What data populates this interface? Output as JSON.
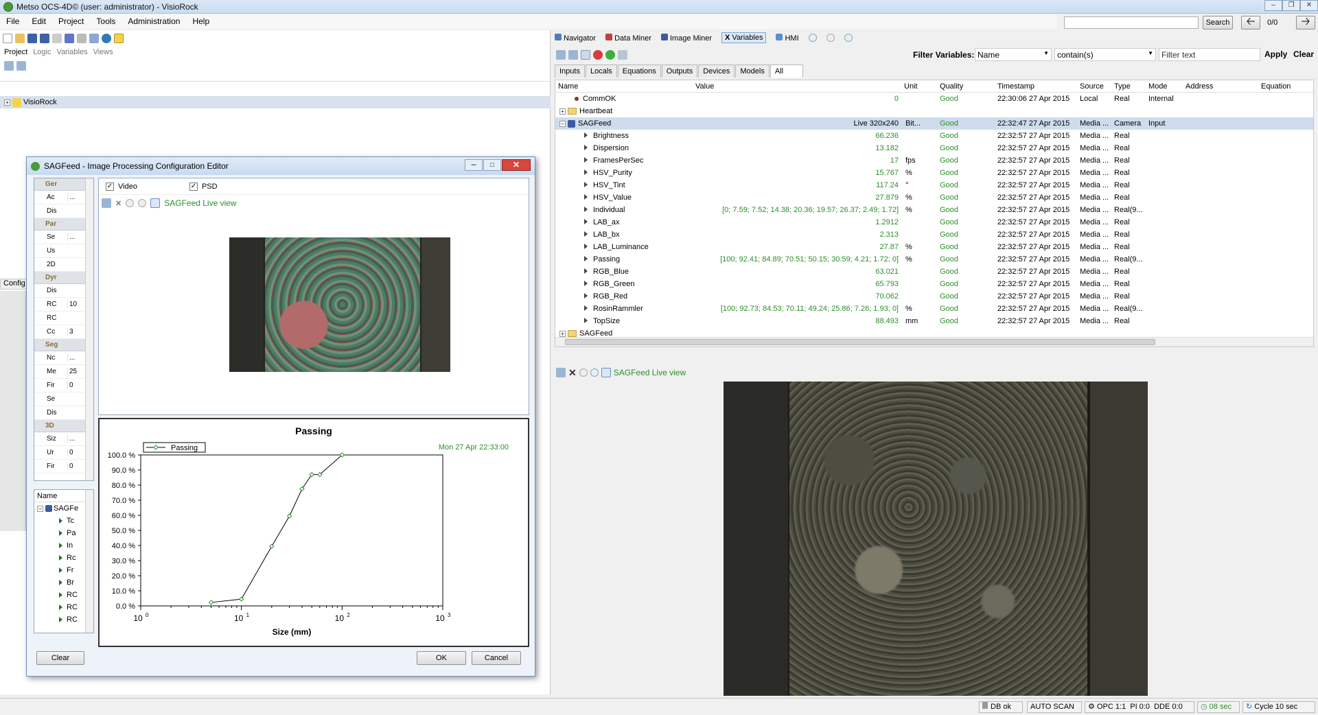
{
  "window": {
    "title": "Metso OCS-4D© (user: administrator) - VisioRock"
  },
  "menu": [
    "File",
    "Edit",
    "Project",
    "Tools",
    "Administration",
    "Help"
  ],
  "search": {
    "button": "Search",
    "count": "0/0"
  },
  "left": {
    "tabs": [
      "Project",
      "Logic",
      "Variables",
      "Views"
    ],
    "tree_root": "VisioRock",
    "partial_tab": "Config"
  },
  "right": {
    "nav_tabs": [
      "Navigator",
      "Data Miner",
      "Image Miner",
      "Variables",
      "HMI"
    ],
    "filter": {
      "label": "Filter Variables:",
      "field": "Name",
      "op": "contain(s)",
      "placeholder": "Filter text",
      "apply": "Apply",
      "clear": "Clear"
    },
    "var_tabs": [
      "Inputs",
      "Locals",
      "Equations",
      "Outputs",
      "Devices",
      "Models",
      "All"
    ],
    "columns": [
      "Name",
      "Value",
      "Unit",
      "Quality",
      "Timestamp",
      "Source",
      "Type",
      "Mode",
      "Address",
      "Equation"
    ],
    "rows": [
      {
        "name": "CommOK",
        "value": "0",
        "unit": "",
        "quality": "Good",
        "ts": "22:30:06  27 Apr 2015",
        "source": "Local",
        "type": "Real",
        "mode": "Internal",
        "kind": "dot"
      },
      {
        "name": "Heartbeat",
        "value": "",
        "unit": "",
        "quality": "",
        "ts": "",
        "source": "",
        "type": "",
        "mode": "",
        "kind": "folder"
      },
      {
        "name": "SAGFeed",
        "value": "Live  320x240",
        "unit": "Bit...",
        "quality": "Good",
        "ts": "22:32:47  27 Apr 2015",
        "source": "Media ...",
        "type": "Camera",
        "mode": "Input",
        "kind": "camera"
      },
      {
        "name": "Brightness",
        "value": "66.236",
        "unit": "",
        "quality": "Good",
        "ts": "22:32:57  27 Apr 2015",
        "source": "Media ...",
        "type": "Real",
        "mode": "",
        "kind": "child"
      },
      {
        "name": "Dispersion",
        "value": "13.182",
        "unit": "",
        "quality": "Good",
        "ts": "22:32:57  27 Apr 2015",
        "source": "Media ...",
        "type": "Real",
        "mode": "",
        "kind": "child"
      },
      {
        "name": "FramesPerSec",
        "value": "17",
        "unit": "fps",
        "quality": "Good",
        "ts": "22:32:57  27 Apr 2015",
        "source": "Media ...",
        "type": "Real",
        "mode": "",
        "kind": "child"
      },
      {
        "name": "HSV_Purity",
        "value": "15.767",
        "unit": "%",
        "quality": "Good",
        "ts": "22:32:57  27 Apr 2015",
        "source": "Media ...",
        "type": "Real",
        "mode": "",
        "kind": "child"
      },
      {
        "name": "HSV_Tint",
        "value": "117.24",
        "unit": "°",
        "quality": "Good",
        "ts": "22:32:57  27 Apr 2015",
        "source": "Media ...",
        "type": "Real",
        "mode": "",
        "kind": "child"
      },
      {
        "name": "HSV_Value",
        "value": "27.879",
        "unit": "%",
        "quality": "Good",
        "ts": "22:32:57  27 Apr 2015",
        "source": "Media ...",
        "type": "Real",
        "mode": "",
        "kind": "child"
      },
      {
        "name": "Individual",
        "value": "[0; 7.59; 7.52; 14.38; 20.36; 19.57; 26.37; 2.49; 1.72]",
        "unit": "%",
        "quality": "Good",
        "ts": "22:32:57  27 Apr 2015",
        "source": "Media ...",
        "type": "Real(9...",
        "mode": "",
        "kind": "child"
      },
      {
        "name": "LAB_ax",
        "value": "1.2912",
        "unit": "",
        "quality": "Good",
        "ts": "22:32:57  27 Apr 2015",
        "source": "Media ...",
        "type": "Real",
        "mode": "",
        "kind": "child"
      },
      {
        "name": "LAB_bx",
        "value": "2.313",
        "unit": "",
        "quality": "Good",
        "ts": "22:32:57  27 Apr 2015",
        "source": "Media ...",
        "type": "Real",
        "mode": "",
        "kind": "child"
      },
      {
        "name": "LAB_Luminance",
        "value": "27.87",
        "unit": "%",
        "quality": "Good",
        "ts": "22:32:57  27 Apr 2015",
        "source": "Media ...",
        "type": "Real",
        "mode": "",
        "kind": "child"
      },
      {
        "name": "Passing",
        "value": "[100; 92.41; 84.89; 70.51; 50.15; 30.59; 4.21; 1.72; 0]",
        "unit": "%",
        "quality": "Good",
        "ts": "22:32:57  27 Apr 2015",
        "source": "Media ...",
        "type": "Real(9...",
        "mode": "",
        "kind": "child"
      },
      {
        "name": "RGB_Blue",
        "value": "63.021",
        "unit": "",
        "quality": "Good",
        "ts": "22:32:57  27 Apr 2015",
        "source": "Media ...",
        "type": "Real",
        "mode": "",
        "kind": "child"
      },
      {
        "name": "RGB_Green",
        "value": "65.793",
        "unit": "",
        "quality": "Good",
        "ts": "22:32:57  27 Apr 2015",
        "source": "Media ...",
        "type": "Real",
        "mode": "",
        "kind": "child"
      },
      {
        "name": "RGB_Red",
        "value": "70.062",
        "unit": "",
        "quality": "Good",
        "ts": "22:32:57  27 Apr 2015",
        "source": "Media ...",
        "type": "Real",
        "mode": "",
        "kind": "child"
      },
      {
        "name": "RosinRammler",
        "value": "[100; 92.73; 84.53; 70.11; 49.24; 25.86; 7.26; 1.93; 0]",
        "unit": "%",
        "quality": "Good",
        "ts": "22:32:57  27 Apr 2015",
        "source": "Media ...",
        "type": "Real(9...",
        "mode": "",
        "kind": "child"
      },
      {
        "name": "TopSize",
        "value": "88.493",
        "unit": "mm",
        "quality": "Good",
        "ts": "22:32:57  27 Apr 2015",
        "source": "Media ...",
        "type": "Real",
        "mode": "",
        "kind": "child"
      },
      {
        "name": "SAGFeed",
        "value": "",
        "unit": "",
        "quality": "",
        "ts": "",
        "source": "",
        "type": "",
        "mode": "",
        "kind": "folder"
      }
    ],
    "live_view": "SAGFeed Live view"
  },
  "dialog": {
    "title": "SAGFeed - Image Processing Configuration Editor",
    "video_label": "Video",
    "psd_label": "PSD",
    "live_view": "SAGFeed Live view",
    "props": [
      {
        "cat": "Ger",
        "rows": [
          [
            "Ac",
            "..."
          ],
          [
            "Dis",
            ""
          ]
        ]
      },
      {
        "cat": "Par",
        "rows": [
          [
            "Se",
            "..."
          ],
          [
            "Us",
            ""
          ],
          [
            "2D",
            ""
          ]
        ]
      },
      {
        "cat": "Dyr",
        "rows": [
          [
            "Dis",
            ""
          ],
          [
            "RC",
            "10"
          ],
          [
            "RC",
            ""
          ],
          [
            "Cc",
            "3"
          ]
        ]
      },
      {
        "cat": "Seg",
        "rows": [
          [
            "Nc",
            "..."
          ],
          [
            "Me",
            "25"
          ],
          [
            "Fir",
            "0"
          ],
          [
            "Se",
            ""
          ],
          [
            "Dis",
            ""
          ]
        ]
      },
      {
        "cat": "3D",
        "rows": [
          [
            "Siz",
            "..."
          ],
          [
            "Ur",
            "0"
          ],
          [
            "Fir",
            "0"
          ]
        ]
      }
    ],
    "tree_header": "Name",
    "tree_root": "SAGFe",
    "tree_items": [
      "Tc",
      "Pa",
      "In",
      "Rc",
      "Fr",
      "Br",
      "RC",
      "RC",
      "RC"
    ],
    "buttons": {
      "clear": "Clear",
      "ok": "OK",
      "cancel": "Cancel"
    }
  },
  "chart_data": {
    "type": "line",
    "title": "Passing",
    "timestamp": "Mon 27 Apr 22:33:00",
    "series": [
      {
        "name": "Passing",
        "x": [
          5,
          10,
          20,
          30,
          40,
          50,
          60,
          100
        ],
        "y": [
          2.3,
          4.5,
          39.5,
          59.5,
          77.5,
          87,
          87,
          100
        ]
      }
    ],
    "xlabel": "Size (mm)",
    "x_scale": "log",
    "xlim": [
      1,
      1000
    ],
    "ylim": [
      0,
      100
    ],
    "yticks": [
      "0.0 %",
      "10.0 %",
      "20.0 %",
      "30.0 %",
      "40.0 %",
      "50.0 %",
      "60.0 %",
      "70.0 %",
      "80.0 %",
      "90.0 %",
      "100.0 %"
    ],
    "xticks": [
      {
        "base": "10",
        "exp": "0"
      },
      {
        "base": "10",
        "exp": "1"
      },
      {
        "base": "10",
        "exp": "2"
      },
      {
        "base": "10",
        "exp": "3"
      }
    ],
    "legend": "top-left",
    "color": "#2a8f2a"
  },
  "status": {
    "db": "DB ok",
    "scan": "AUTO SCAN",
    "opc": "OPC 1:1",
    "pi": "PI 0:0",
    "dde": "DDE 0:0",
    "timer": "08 sec",
    "cycle": "Cycle 10 sec"
  },
  "colors": {
    "accent": "#2a8f2a",
    "selection": "#cfdced"
  }
}
